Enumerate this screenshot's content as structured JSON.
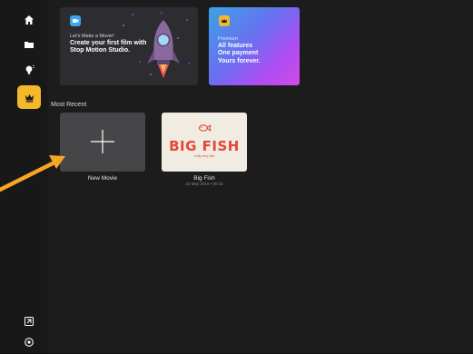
{
  "sidebar": {
    "items": [
      {
        "icon": "home-icon",
        "active": false
      },
      {
        "icon": "folder-icon",
        "active": false
      },
      {
        "icon": "lightbulb-icon",
        "active": false
      },
      {
        "icon": "crown-icon",
        "active": true
      }
    ],
    "bottom": [
      {
        "icon": "import-icon"
      },
      {
        "icon": "settings-icon"
      }
    ]
  },
  "banners": {
    "film": {
      "small": "Let's Make a Movie!",
      "line1": "Create your first film with",
      "line2": "Stop Motion Studio."
    },
    "premium": {
      "small": "Premium",
      "line1": "All features",
      "line2": "One payment",
      "line3": "Yours forever."
    }
  },
  "section": {
    "title": "Most Recent"
  },
  "tiles": {
    "new_movie": {
      "label": "New Movie"
    },
    "big_fish": {
      "label": "Big Fish",
      "meta": "22 May 2016 • 00:15",
      "poster_title": "BIG FISH",
      "poster_sub": "a big story fish"
    }
  },
  "colors": {
    "accent": "#f4b92a",
    "arrow": "#f5a623",
    "background": "#1c1c1d"
  }
}
